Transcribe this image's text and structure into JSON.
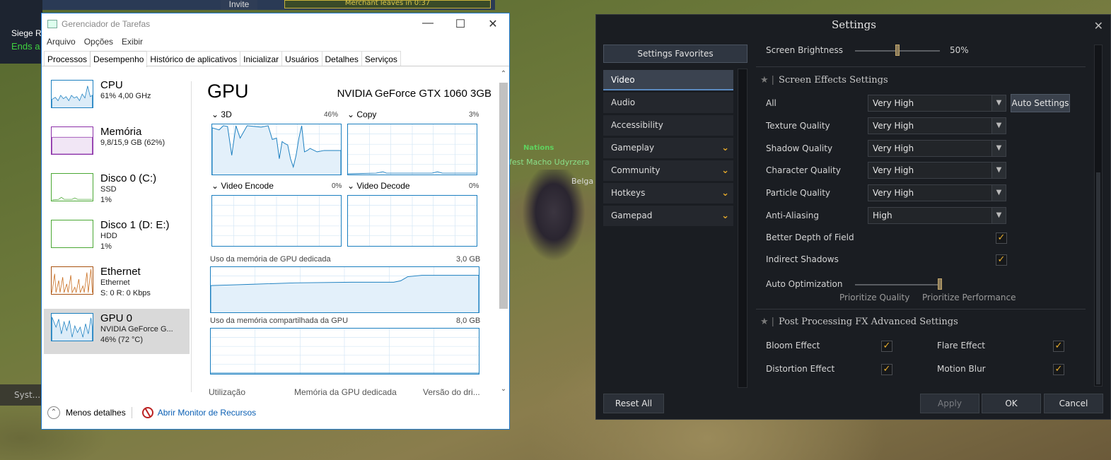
{
  "game": {
    "invite_label": "Invite",
    "merchant_banner": "Merchant leaves in 0:37",
    "siege_text": "Siege R",
    "ends_text": "Ends a",
    "chat_text": "Syst...",
    "char_name": "Nations",
    "char_title": "fest Macho Udyrzera",
    "char_belga": "Belga"
  },
  "taskmgr": {
    "title": "Gerenciador de Tarefas",
    "menu": [
      "Arquivo",
      "Opções",
      "Exibir"
    ],
    "tabs": [
      "Processos",
      "Desempenho",
      "Histórico de aplicativos",
      "Inicializar",
      "Usuários",
      "Detalhes",
      "Serviços"
    ],
    "active_tab": "Desempenho",
    "resources": [
      {
        "name": "CPU",
        "line1": "61% 4,00 GHz",
        "line2": "",
        "line3": "",
        "color": "#1b7fc0"
      },
      {
        "name": "Memória",
        "line1": "9,8/15,9 GB (62%)",
        "line2": "",
        "line3": "",
        "color": "#8b2fa8"
      },
      {
        "name": "Disco 0 (C:)",
        "line1": "SSD",
        "line2": "1%",
        "line3": "",
        "color": "#4aa834"
      },
      {
        "name": "Disco 1 (D: E:)",
        "line1": "HDD",
        "line2": "1%",
        "line3": "",
        "color": "#4aa834"
      },
      {
        "name": "Ethernet",
        "line1": "Ethernet",
        "line2": "S: 0  R: 0 Kbps",
        "line3": "",
        "color": "#a8510f"
      },
      {
        "name": "GPU 0",
        "line1": "NVIDIA GeForce G...",
        "line2": "46% (72 °C)",
        "line3": "",
        "color": "#1b7fc0"
      }
    ],
    "gpu": {
      "title": "GPU",
      "model": "NVIDIA GeForce GTX 1060 3GB",
      "engines": [
        {
          "label": "3D",
          "pct": "46%"
        },
        {
          "label": "Copy",
          "pct": "3%"
        },
        {
          "label": "Video Encode",
          "pct": "0%"
        },
        {
          "label": "Video Decode",
          "pct": "0%"
        }
      ],
      "dedicated_label": "Uso da memória de GPU dedicada",
      "dedicated_max": "3,0 GB",
      "shared_label": "Uso da memória compartilhada da GPU",
      "shared_max": "8,0 GB",
      "footer_cols": [
        "Utilização",
        "Memória da GPU dedicada",
        "Versão do dri..."
      ]
    },
    "footer": {
      "less_details": "Menos detalhes",
      "open_monitor": "Abrir Monitor de Recursos"
    }
  },
  "settings": {
    "title": "Settings",
    "favorites_label": "Settings Favorites",
    "nav": [
      {
        "label": "Video",
        "expandable": false,
        "active": true
      },
      {
        "label": "Audio",
        "expandable": false,
        "active": false
      },
      {
        "label": "Accessibility",
        "expandable": false,
        "active": false
      },
      {
        "label": "Gameplay",
        "expandable": true,
        "active": false
      },
      {
        "label": "Community",
        "expandable": true,
        "active": false
      },
      {
        "label": "Hotkeys",
        "expandable": true,
        "active": false
      },
      {
        "label": "Gamepad",
        "expandable": true,
        "active": false
      }
    ],
    "brightness_label": "Screen Brightness",
    "brightness_value": "50%",
    "brightness_level": 0.5,
    "screen_effects_header": "Screen Effects Settings",
    "quality_rows": [
      {
        "label": "All",
        "value": "Very High"
      },
      {
        "label": "Texture Quality",
        "value": "Very High"
      },
      {
        "label": "Shadow Quality",
        "value": "Very High"
      },
      {
        "label": "Character Quality",
        "value": "Very High"
      },
      {
        "label": "Particle Quality",
        "value": "Very High"
      },
      {
        "label": "Anti-Aliasing",
        "value": "High"
      }
    ],
    "auto_settings_label": "Auto Settings",
    "better_dof_label": "Better Depth of Field",
    "better_dof_checked": true,
    "indirect_shadows_label": "Indirect Shadows",
    "indirect_shadows_checked": true,
    "auto_opt_label": "Auto Optimization",
    "auto_opt_level": 1.0,
    "prioritize_quality": "Prioritize Quality",
    "prioritize_performance": "Prioritize Performance",
    "post_fx_header": "Post Processing FX Advanced Settings",
    "post_fx": [
      {
        "label": "Bloom Effect",
        "checked": true
      },
      {
        "label": "Flare Effect",
        "checked": true
      },
      {
        "label": "Distortion Effect",
        "checked": true
      },
      {
        "label": "Motion Blur",
        "checked": true
      }
    ],
    "buttons": {
      "reset": "Reset All",
      "apply": "Apply",
      "ok": "OK",
      "cancel": "Cancel"
    },
    "accent_color": "#e7ad2e"
  }
}
